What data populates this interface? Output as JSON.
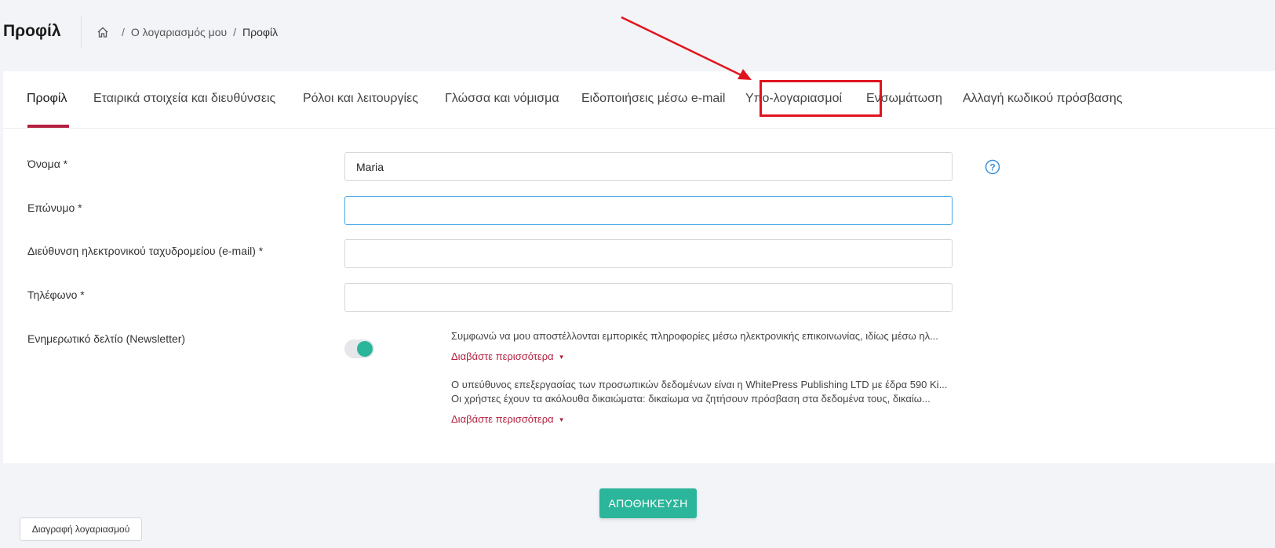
{
  "header": {
    "title": "Προφίλ",
    "breadcrumb": {
      "home_icon": "home-icon",
      "items": [
        "Ο λογαριασμός μου",
        "Προφίλ"
      ],
      "separator": "/"
    }
  },
  "tabs": [
    {
      "label": "Προφίλ",
      "active": true
    },
    {
      "label": "Εταιρικά στοιχεία και διευθύνσεις",
      "active": false
    },
    {
      "label": "Ρόλοι και λειτουργίες",
      "active": false
    },
    {
      "label": "Γλώσσα και νόμισμα",
      "active": false
    },
    {
      "label": "Ειδοποιήσεις μέσω e-mail",
      "active": false
    },
    {
      "label": "Υπο-λογαριασμοί",
      "active": false
    },
    {
      "label": "Ενσωμάτωση",
      "active": false
    },
    {
      "label": "Αλλαγή κωδικού πρόσβασης",
      "active": false
    }
  ],
  "form": {
    "first_name": {
      "label": "Όνομα *",
      "value": "Maria"
    },
    "last_name": {
      "label": "Επώνυμο *",
      "value": ""
    },
    "email": {
      "label": "Διεύθυνση ηλεκτρονικού ταχυδρομείου (e-mail) *",
      "value": ""
    },
    "phone": {
      "label": "Τηλέφωνο *",
      "value": ""
    },
    "newsletter": {
      "label": "Ενημερωτικό δελτίο (Newsletter)",
      "enabled": true,
      "consent_text": "Συμφωνώ να μου αποστέλλονται εμπορικές πληροφορίες μέσω ηλεκτρονικής επικοινωνίας, ιδίως μέσω ηλ...",
      "read_more": "Διαβάστε περισσότερα"
    },
    "privacy": {
      "line1": "Ο υπεύθυνος επεξεργασίας των προσωπικών δεδομένων είναι η WhitePress Publishing LTD με έδρα 590 Ki...",
      "line2": "Οι χρήστες έχουν τα ακόλουθα δικαιώματα: δικαίωμα να ζητήσουν πρόσβαση στα δεδομένα τους, δικαίω...",
      "read_more": "Διαβάστε περισσότερα"
    }
  },
  "actions": {
    "save_label": "ΑΠΟΘΗΚΕΥΣΗ",
    "delete_label": "Διαγραφή λογαριασμού"
  },
  "colors": {
    "accent_red": "#b4203f",
    "save_green": "#2bb59a",
    "annotation_red": "#e0141e",
    "help_blue": "#3a8fd9"
  }
}
